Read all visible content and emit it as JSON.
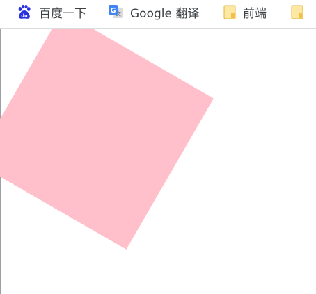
{
  "bookmarks_bar": {
    "items": [
      {
        "label": "百度一下",
        "icon": "baidu-paw-icon"
      },
      {
        "label": "Google 翻译",
        "icon": "google-translate-icon"
      },
      {
        "label": "前端",
        "icon": "folder-icon"
      },
      {
        "label": "",
        "icon": "folder-icon"
      }
    ]
  },
  "page": {
    "rotated_square": {
      "color": "#ffc0cb",
      "rotation_degrees": 30
    }
  }
}
